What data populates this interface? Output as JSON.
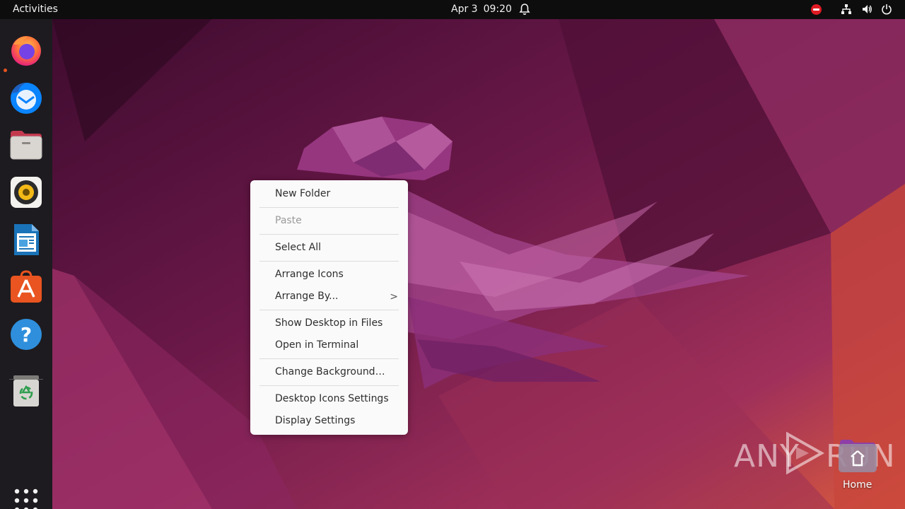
{
  "topbar": {
    "activities": "Activities",
    "date": "Apr 3",
    "time": "09:20"
  },
  "dock": {
    "items": [
      {
        "name": "firefox-icon"
      },
      {
        "name": "thunderbird-icon"
      },
      {
        "name": "files-icon"
      },
      {
        "name": "rhythmbox-icon"
      },
      {
        "name": "libreoffice-writer-icon"
      },
      {
        "name": "app-center-icon"
      },
      {
        "name": "help-icon"
      },
      {
        "name": "trash-icon"
      }
    ]
  },
  "context_menu": {
    "new_folder": "New Folder",
    "paste": "Paste",
    "select_all": "Select All",
    "arrange_icons": "Arrange Icons",
    "arrange_by": "Arrange By...",
    "arrange_by_chevron": ">",
    "show_desktop_in_files": "Show Desktop in Files",
    "open_in_terminal": "Open in Terminal",
    "change_background": "Change Background…",
    "desktop_icons_settings": "Desktop Icons Settings",
    "display_settings": "Display Settings"
  },
  "desktop": {
    "home_label": "Home"
  },
  "watermark": {
    "text_left": "ANY",
    "text_right": "RUN"
  },
  "colors": {
    "accent": "#e95420",
    "topbar": "#0d0d0d",
    "dock": "#1d1b1f",
    "menu_bg": "#fafafa"
  }
}
